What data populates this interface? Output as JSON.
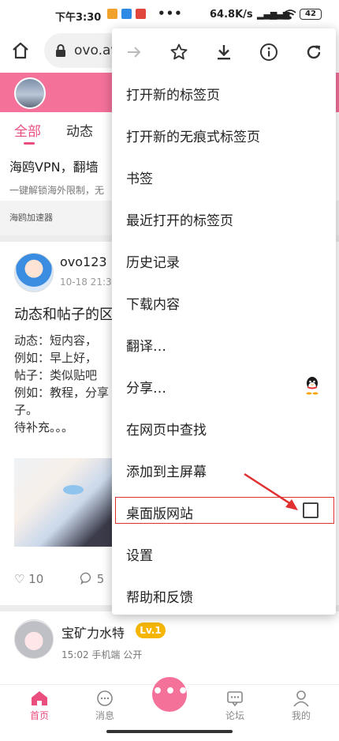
{
  "status_bar": {
    "time": "下午3:30",
    "speed": "64.8K/s",
    "signal1": "4G",
    "signal2": "4G",
    "battery": "42"
  },
  "address_bar": {
    "url": "ovo.av"
  },
  "page": {
    "tabs": [
      "全部",
      "动态"
    ],
    "ad": {
      "title": "海鸥VPN，翻墙 ",
      "desc": "一键解锁海外限制，无",
      "footer": "海鸥加速器"
    },
    "post": {
      "user": "ovo123",
      "meta": "10-18 21:35",
      "title": "动态和帖子的区",
      "body": [
        "动态：短内容，",
        "例如：早上好，",
        "帖子：类似贴吧",
        "例如：教程，分享",
        "子。",
        "待补充。。。"
      ],
      "likes": "10",
      "comments": "5"
    },
    "post2": {
      "user": "宝矿力水特",
      "level": "Lv.1",
      "meta": "15:02  手机端  公开"
    }
  },
  "bottom_nav": {
    "items": [
      "首页",
      "消息",
      "论坛",
      "我的"
    ],
    "center": "•••"
  },
  "menu": {
    "items": [
      "打开新的标签页",
      "打开新的无痕式标签页",
      "书签",
      "最近打开的标签页",
      "历史记录",
      "下载内容",
      "翻译…",
      "分享…",
      "在网页中查找",
      "添加到主屏幕",
      "桌面版网站",
      "设置",
      "帮助和反馈"
    ]
  },
  "colors": {
    "brand_pink": "#f4719a",
    "accent_pink": "#ea4e7f",
    "highlight_red": "#e03030",
    "level_badge": "#f5b500"
  }
}
